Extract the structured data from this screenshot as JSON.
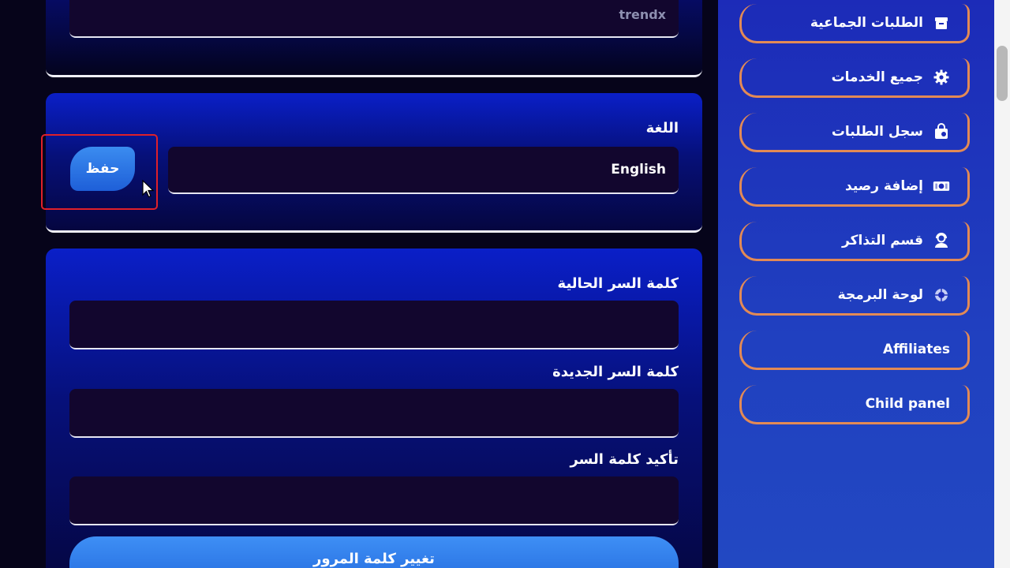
{
  "profile": {
    "username_value": "trendx",
    "language_label": "اللغة",
    "language_value": "English",
    "save_button": "حفظ",
    "current_password_label": "كلمة السر الحالية",
    "new_password_label": "كلمة السر الجديدة",
    "confirm_password_label": "تأكيد كلمة السر",
    "change_password_button": "تغيير كلمة المرور"
  },
  "sidebar": {
    "items": [
      {
        "label": "الطلبات الجماعية",
        "icon": "box-icon"
      },
      {
        "label": "جميع الخدمات",
        "icon": "gear-icon"
      },
      {
        "label": "سجل الطلبات",
        "icon": "shopping-bag-icon"
      },
      {
        "label": "إضافة رصيد",
        "icon": "money-icon"
      },
      {
        "label": "قسم التذاكر",
        "icon": "support-agent-icon"
      },
      {
        "label": "لوحة البرمجة",
        "icon": "code-brain-icon"
      },
      {
        "label": "Affiliates",
        "icon": ""
      },
      {
        "label": "Child panel",
        "icon": ""
      }
    ]
  },
  "colors": {
    "accent": "#3b8cf0",
    "nav_border": "#e38a55",
    "highlight": "#e0202a"
  }
}
